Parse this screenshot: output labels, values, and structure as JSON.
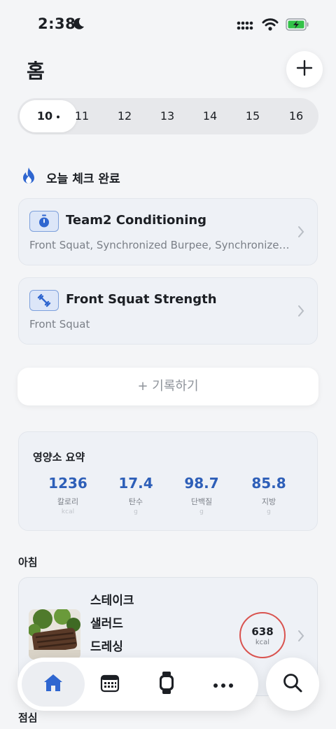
{
  "status": {
    "time": "2:38"
  },
  "header": {
    "title": "홈"
  },
  "dates": {
    "selected": "10",
    "others": [
      "11",
      "12",
      "13",
      "14",
      "15",
      "16"
    ]
  },
  "check": {
    "title": "오늘 체크 완료"
  },
  "workouts": [
    {
      "title": "Team2 Conditioning",
      "subtitle": "Front Squat, Synchronized Burpee, Synchronized Burpee"
    },
    {
      "title": "Front Squat Strength",
      "subtitle": "Front Squat"
    }
  ],
  "record_button": "+ 기록하기",
  "nutrition": {
    "title": "영양소 요약",
    "items": [
      {
        "value": "1236",
        "label": "칼로리",
        "unit": "kcal"
      },
      {
        "value": "17.4",
        "label": "탄수",
        "unit": "g"
      },
      {
        "value": "98.7",
        "label": "단백질",
        "unit": "g"
      },
      {
        "value": "85.8",
        "label": "지방",
        "unit": "g"
      }
    ]
  },
  "meals": {
    "breakfast_label": "아침",
    "breakfast": {
      "name_lines": [
        "스테이크",
        "샐러드",
        "드레싱"
      ],
      "kcal": "638",
      "kcal_unit": "kcal"
    },
    "lunch_label": "점심"
  },
  "colors": {
    "accent": "#2e5fb8",
    "kcal_ring": "#d9534f",
    "flame": "#2f66d0"
  },
  "icons": {
    "home": "home-icon",
    "calendar": "calendar-icon",
    "watch": "watch-icon",
    "more": "more-icon",
    "search": "search-icon"
  }
}
